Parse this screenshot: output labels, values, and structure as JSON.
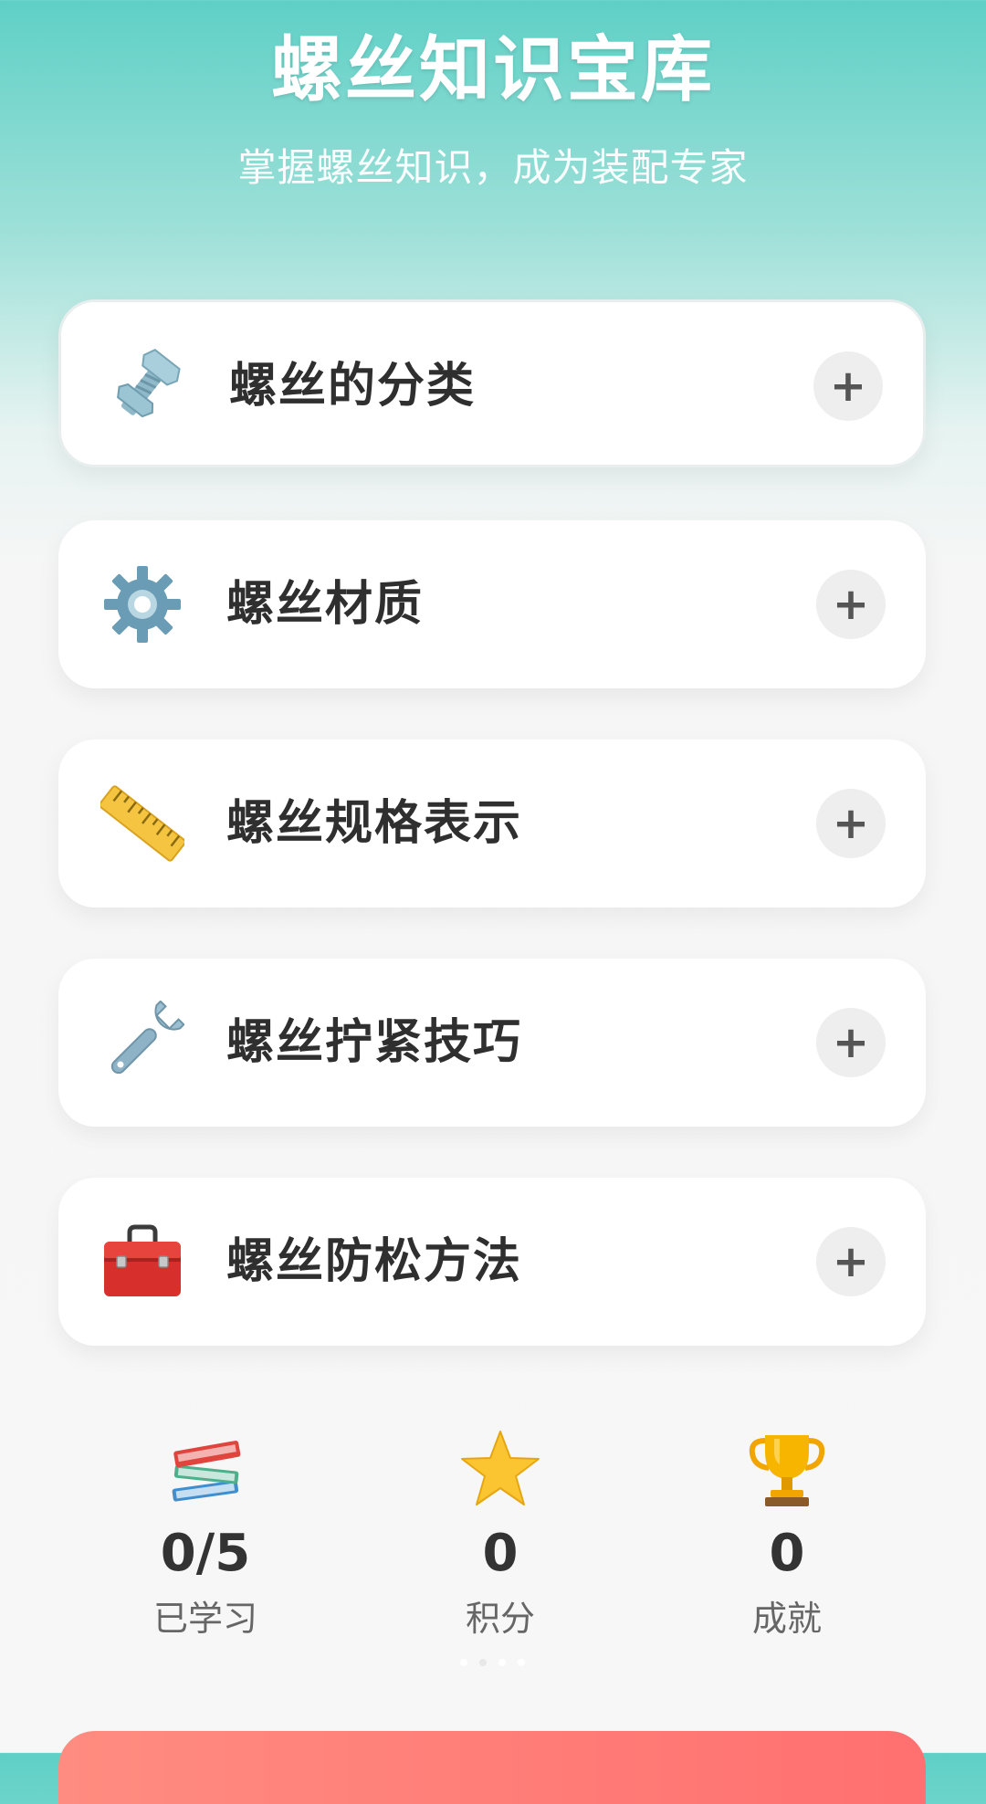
{
  "header": {
    "title": "螺丝知识宝库",
    "subtitle": "掌握螺丝知识，成为装配专家"
  },
  "topics": [
    {
      "label": "螺丝的分类",
      "icon": "nut-and-bolt-icon",
      "action": "+"
    },
    {
      "label": "螺丝材质",
      "icon": "gear-icon",
      "action": "+"
    },
    {
      "label": "螺丝规格表示",
      "icon": "ruler-icon",
      "action": "+"
    },
    {
      "label": "螺丝拧紧技巧",
      "icon": "wrench-icon",
      "action": "+"
    },
    {
      "label": "螺丝防松方法",
      "icon": "toolbox-icon",
      "action": "+"
    }
  ],
  "stats": [
    {
      "value": "0/5",
      "label": "已学习",
      "icon": "books-icon"
    },
    {
      "value": "0",
      "label": "积分",
      "icon": "star-icon"
    },
    {
      "value": "0",
      "label": "成就",
      "icon": "trophy-icon"
    }
  ],
  "colors": {
    "header_gradient_top": "#5fd0c6",
    "background": "#f7f7f7",
    "card": "#ffffff",
    "expand_button": "#eeeeee",
    "start_button": "#ff7b72"
  }
}
